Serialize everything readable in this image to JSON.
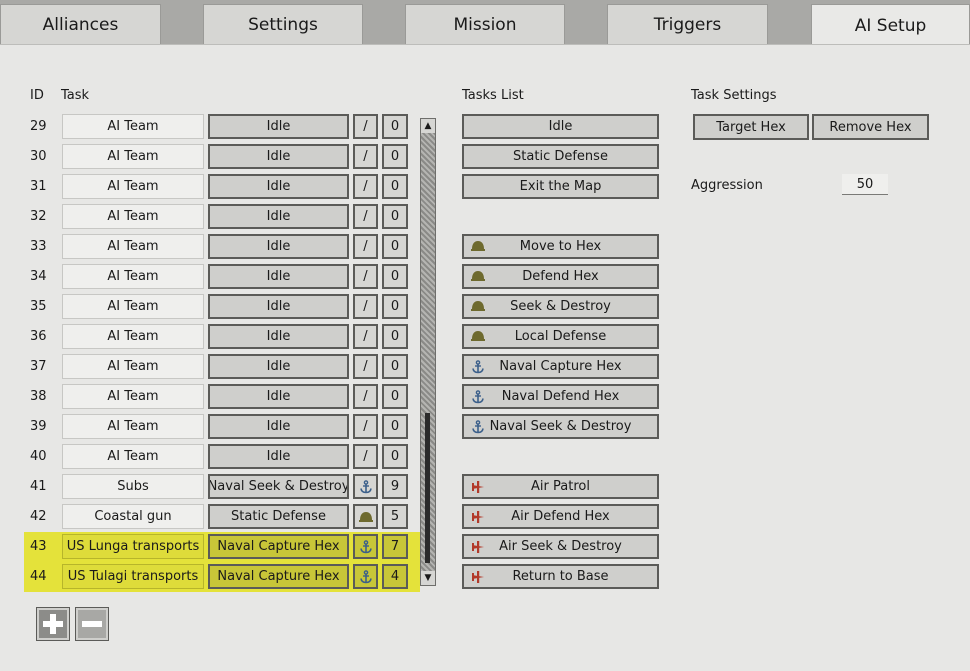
{
  "tabs": [
    {
      "label": "Alliances"
    },
    {
      "label": "Settings"
    },
    {
      "label": "Mission"
    },
    {
      "label": "Triggers"
    },
    {
      "label": "AI Setup",
      "active": true
    }
  ],
  "headers": {
    "id": "ID",
    "task": "Task",
    "tasks_list": "Tasks List",
    "task_settings": "Task Settings"
  },
  "rows": [
    {
      "id": "29",
      "name": "AI Team",
      "task": "Idle",
      "icon": "slash",
      "num": "0"
    },
    {
      "id": "30",
      "name": "AI Team",
      "task": "Idle",
      "icon": "slash",
      "num": "0"
    },
    {
      "id": "31",
      "name": "AI Team",
      "task": "Idle",
      "icon": "slash",
      "num": "0"
    },
    {
      "id": "32",
      "name": "AI Team",
      "task": "Idle",
      "icon": "slash",
      "num": "0"
    },
    {
      "id": "33",
      "name": "AI Team",
      "task": "Idle",
      "icon": "slash",
      "num": "0"
    },
    {
      "id": "34",
      "name": "AI Team",
      "task": "Idle",
      "icon": "slash",
      "num": "0"
    },
    {
      "id": "35",
      "name": "AI Team",
      "task": "Idle",
      "icon": "slash",
      "num": "0"
    },
    {
      "id": "36",
      "name": "AI Team",
      "task": "Idle",
      "icon": "slash",
      "num": "0"
    },
    {
      "id": "37",
      "name": "AI Team",
      "task": "Idle",
      "icon": "slash",
      "num": "0"
    },
    {
      "id": "38",
      "name": "AI Team",
      "task": "Idle",
      "icon": "slash",
      "num": "0"
    },
    {
      "id": "39",
      "name": "AI Team",
      "task": "Idle",
      "icon": "slash",
      "num": "0"
    },
    {
      "id": "40",
      "name": "AI Team",
      "task": "Idle",
      "icon": "slash",
      "num": "0"
    },
    {
      "id": "41",
      "name": "Subs",
      "task": "Naval Seek & Destroy",
      "icon": "anchor-icon",
      "num": "9"
    },
    {
      "id": "42",
      "name": "Coastal gun",
      "task": "Static Defense",
      "icon": "helmet-icon",
      "num": "5"
    },
    {
      "id": "43",
      "name": "US Lunga transports",
      "task": "Naval Capture Hex",
      "icon": "anchor-icon",
      "num": "7",
      "highlighted": true
    },
    {
      "id": "44",
      "name": "US Tulagi transports",
      "task": "Naval Capture Hex",
      "icon": "anchor-icon",
      "num": "4",
      "highlighted": true
    }
  ],
  "tasks_list": [
    {
      "label": "Idle",
      "icon": ""
    },
    {
      "label": "Static Defense",
      "icon": ""
    },
    {
      "label": "Exit the Map",
      "icon": ""
    },
    {
      "label": "Move to Hex",
      "icon": "helmet-icon"
    },
    {
      "label": "Defend Hex",
      "icon": "helmet-icon"
    },
    {
      "label": "Seek & Destroy",
      "icon": "helmet-icon"
    },
    {
      "label": "Local Defense",
      "icon": "helmet-icon"
    },
    {
      "label": "Naval Capture Hex",
      "icon": "anchor-icon"
    },
    {
      "label": "Naval Defend Hex",
      "icon": "anchor-icon"
    },
    {
      "label": "Naval Seek & Destroy",
      "icon": "anchor-icon"
    },
    {
      "label": "Air Patrol",
      "icon": "plane-icon"
    },
    {
      "label": "Air Defend Hex",
      "icon": "plane-icon"
    },
    {
      "label": "Air Seek & Destroy",
      "icon": "plane-icon"
    },
    {
      "label": "Return to Base",
      "icon": "plane-icon"
    }
  ],
  "task_settings": {
    "target_hex": "Target Hex",
    "remove_hex": "Remove Hex",
    "aggression_label": "Aggression",
    "aggression_value": "50"
  },
  "colors": {
    "highlight": "#e4e23a",
    "button_border": "#5b5b58",
    "helmet": "#6e6a2e",
    "anchor": "#3b5f8a",
    "plane": "#b23a2a"
  }
}
